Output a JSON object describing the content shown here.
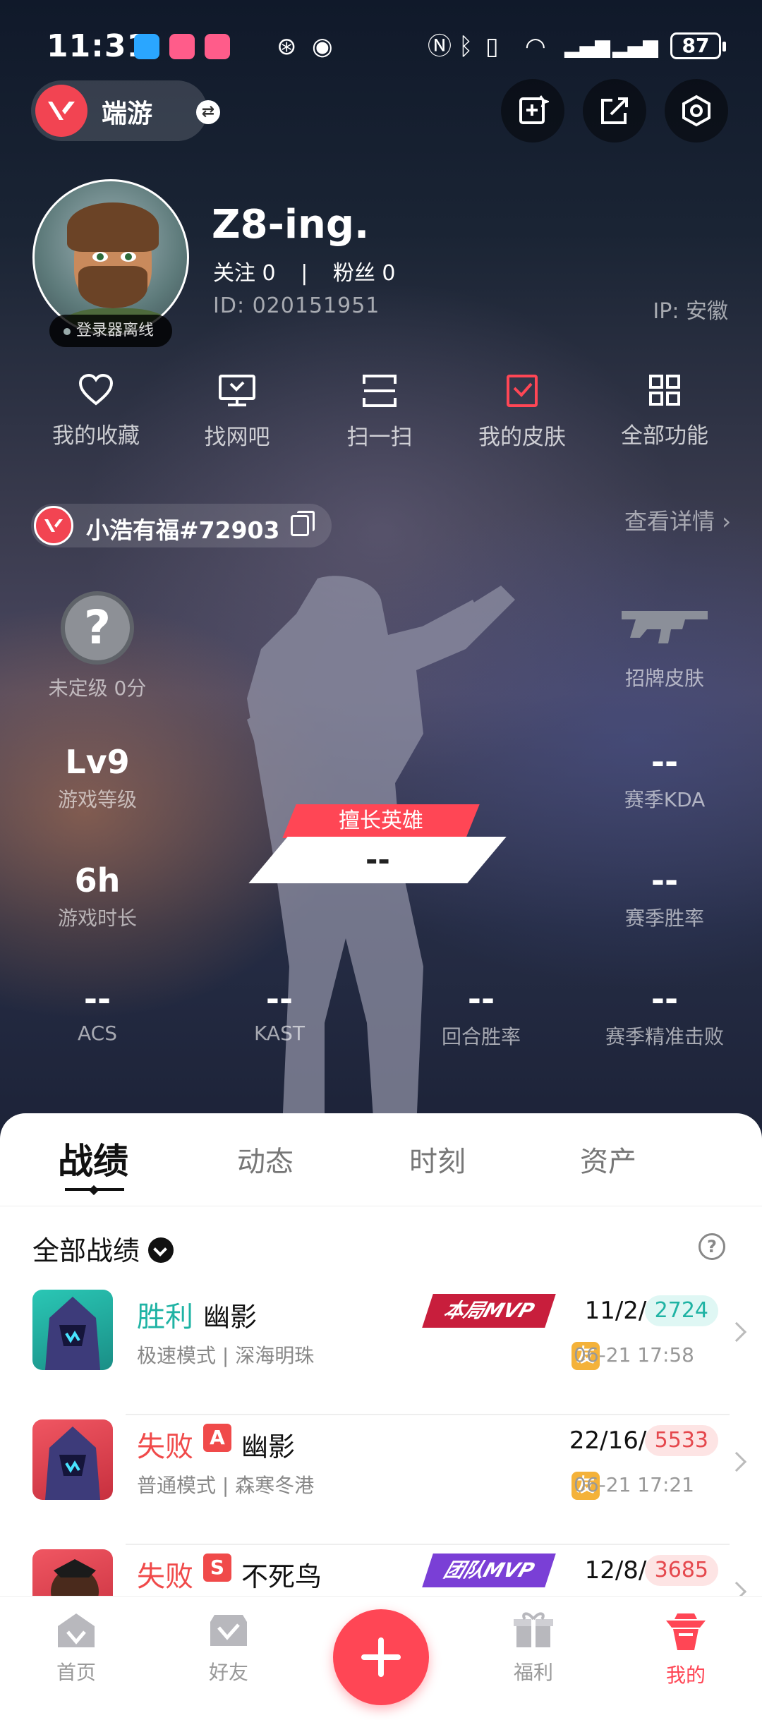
{
  "status_bar": {
    "time": "11:31",
    "battery": "87"
  },
  "header": {
    "game_label": "端游"
  },
  "profile": {
    "username": "Z8-ing.",
    "follow_label": "关注",
    "follow_count": "0",
    "fans_label": "粉丝",
    "fans_count": "0",
    "id_text": "ID:  020151951",
    "ip_text": "IP:  安徽",
    "login_status": "登录器离线"
  },
  "quick_actions": [
    {
      "label": "我的收藏",
      "icon": "heart-icon"
    },
    {
      "label": "找网吧",
      "icon": "monitor-icon"
    },
    {
      "label": "扫一扫",
      "icon": "scan-icon"
    },
    {
      "label": "我的皮肤",
      "icon": "skin-icon"
    },
    {
      "label": "全部功能",
      "icon": "grid-icon"
    }
  ],
  "account": {
    "name": "小浩有福#72903",
    "detail_link": "查看详情"
  },
  "stats": {
    "rank": {
      "label": "未定级 0分"
    },
    "signature_skin": {
      "label": "招牌皮肤"
    },
    "level": {
      "value": "Lv9",
      "label": "游戏等级"
    },
    "season_kda": {
      "value": "--",
      "label": "赛季KDA"
    },
    "play_time": {
      "value": "6h",
      "label": "游戏时长"
    },
    "season_winrate": {
      "value": "--",
      "label": "赛季胜率"
    },
    "acs": {
      "value": "--",
      "label": "ACS"
    },
    "kast": {
      "value": "--",
      "label": "KAST"
    },
    "round_winrate": {
      "value": "--",
      "label": "回合胜率"
    },
    "season_headshot": {
      "value": "--",
      "label": "赛季精准击败"
    },
    "best_hero": {
      "label": "擅长英雄",
      "value": "--"
    }
  },
  "tabs": [
    {
      "label": "战绩",
      "active": true
    },
    {
      "label": "动态",
      "active": false
    },
    {
      "label": "时刻",
      "active": false
    },
    {
      "label": "资产",
      "active": false
    }
  ],
  "filter": {
    "label": "全部战绩"
  },
  "matches": [
    {
      "result": "胜利",
      "outcome": "win",
      "tag": "",
      "agent": "幽影",
      "mode": "极速模式 | 深海明珠",
      "mvp": "本局MVP",
      "mvp_color": "#c81e3c",
      "kda": "11/2/1",
      "score": "2724",
      "friend": "友",
      "time": "06-21 17:58",
      "thumb_color": "#1fb8a8"
    },
    {
      "result": "失败",
      "outcome": "lose",
      "tag": "A",
      "agent": "幽影",
      "mode": "普通模式 | 森寒冬港",
      "mvp": "",
      "mvp_color": "",
      "kda": "22/16/2",
      "score": "5533",
      "friend": "友",
      "time": "06-21 17:21",
      "thumb_color": "#e8434f"
    },
    {
      "result": "失败",
      "outcome": "lose",
      "tag": "S",
      "agent": "不死鸟",
      "mode": "",
      "mvp": "团队MVP",
      "mvp_color": "#7a3fd6",
      "kda": "12/8/1",
      "score": "3685",
      "friend": "",
      "time": "",
      "thumb_color": "#e8434f"
    }
  ],
  "nav": [
    {
      "label": "首页"
    },
    {
      "label": "好友"
    },
    {
      "label": "福利"
    },
    {
      "label": "我的"
    }
  ],
  "colors": {
    "accent": "#ff4655",
    "win": "#1fb3a4",
    "lose": "#f04a4a"
  }
}
